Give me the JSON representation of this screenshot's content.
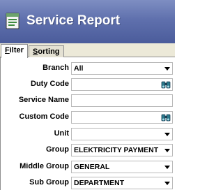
{
  "window": {
    "title": "Service Report",
    "icon": "report-icon"
  },
  "tabs": [
    {
      "label_first": "F",
      "label_rest": "ilter",
      "active": true
    },
    {
      "label_first": "S",
      "label_rest": "orting",
      "active": false
    }
  ],
  "filters": {
    "branch": {
      "label": "Branch",
      "value": "All"
    },
    "duty_code": {
      "label": "Duty Code",
      "value": "",
      "icon": "binoculars-icon"
    },
    "service_name": {
      "label": "Service Name",
      "value": ""
    },
    "custom_code": {
      "label": "Custom Code",
      "value": "",
      "icon": "binoculars-icon"
    },
    "unit": {
      "label": "Unit",
      "value": ""
    },
    "group": {
      "label": "Group",
      "value": "ELEKTRICITY PAYMENT"
    },
    "middle_group": {
      "label": "Middle Group",
      "value": "GENERAL"
    },
    "sub_group": {
      "label": "Sub Group",
      "value": "DEPARTMENT"
    }
  },
  "colors": {
    "titlebar": "#5f70ad",
    "title_text": "#ffffff",
    "tab_bar": "#ece9d8"
  }
}
